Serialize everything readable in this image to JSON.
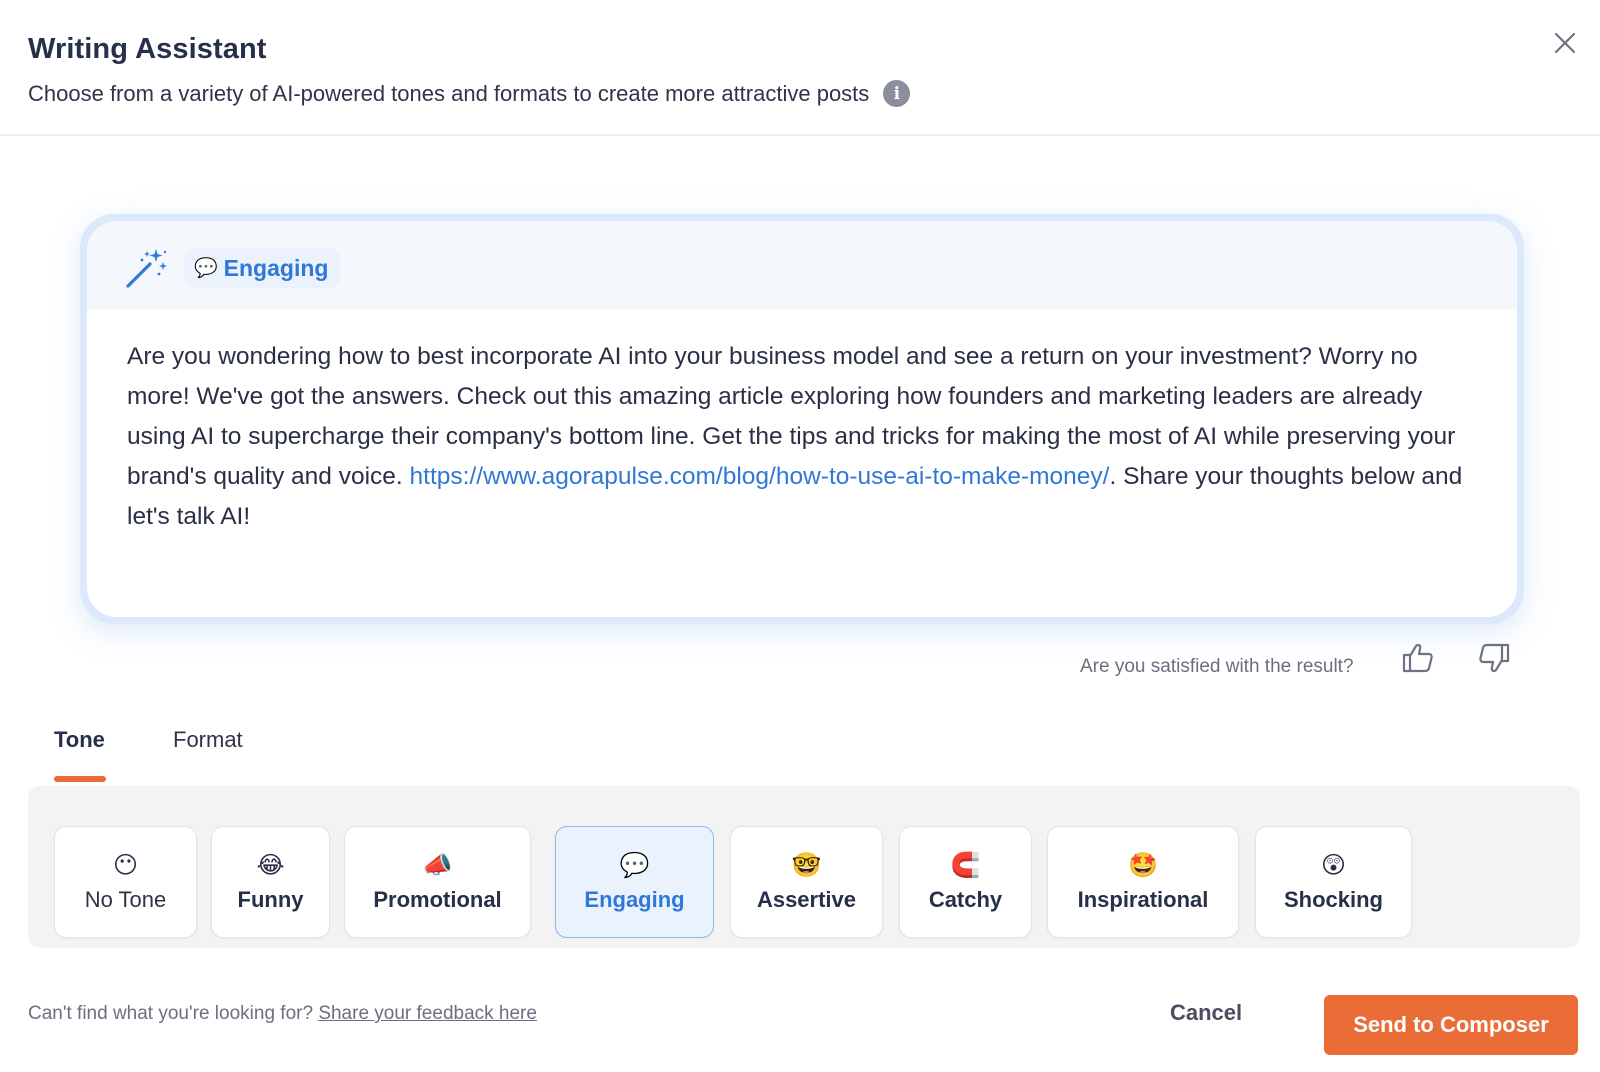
{
  "header": {
    "title": "Writing Assistant",
    "subtitle": "Choose from a variety of AI-powered tones and formats to create more attractive posts",
    "info_icon": "info-icon",
    "close_icon": "close-icon"
  },
  "result": {
    "tone_emoji": "💬",
    "tone_label": "Engaging",
    "text_before_link": "Are you wondering how to best incorporate AI into your business model and see a return on your investment? Worry no more! We've got the answers. Check out this amazing article exploring how founders and marketing leaders are already using AI to supercharge their company's bottom line. Get the tips and tricks for making the most of AI while preserving your brand's quality and voice.",
    "link": "https://www.agorapulse.com/blog/how-to-use-ai-to-make-money/",
    "text_after_link": ". Share your thoughts below and let's talk AI!"
  },
  "feedback": {
    "question": "Are you satisfied with the result?",
    "thumbs_up_icon": "thumbs-up-icon",
    "thumbs_down_icon": "thumbs-down-icon"
  },
  "tabs": [
    {
      "label": "Tone",
      "active": true
    },
    {
      "label": "Format",
      "active": false
    }
  ],
  "tones": [
    {
      "emoji": "😶",
      "label": "No Tone",
      "selected": false
    },
    {
      "emoji": "😂",
      "label": "Funny",
      "selected": false
    },
    {
      "emoji": "📣",
      "label": "Promotional",
      "selected": false
    },
    {
      "emoji": "💬",
      "label": "Engaging",
      "selected": true
    },
    {
      "emoji": "🤓",
      "label": "Assertive",
      "selected": false
    },
    {
      "emoji": "🧲",
      "label": "Catchy",
      "selected": false
    },
    {
      "emoji": "🤩",
      "label": "Inspirational",
      "selected": false
    },
    {
      "emoji": "😲",
      "label": "Shocking",
      "selected": false
    }
  ],
  "footer": {
    "prompt": "Can't find what you're looking for?",
    "feedback_link": "Share your feedback here",
    "cancel_label": "Cancel",
    "send_label": "Send to Composer"
  },
  "colors": {
    "accent_orange": "#ea6d38",
    "link_blue": "#2f78d6",
    "selected_bg": "#eaf3fd"
  }
}
